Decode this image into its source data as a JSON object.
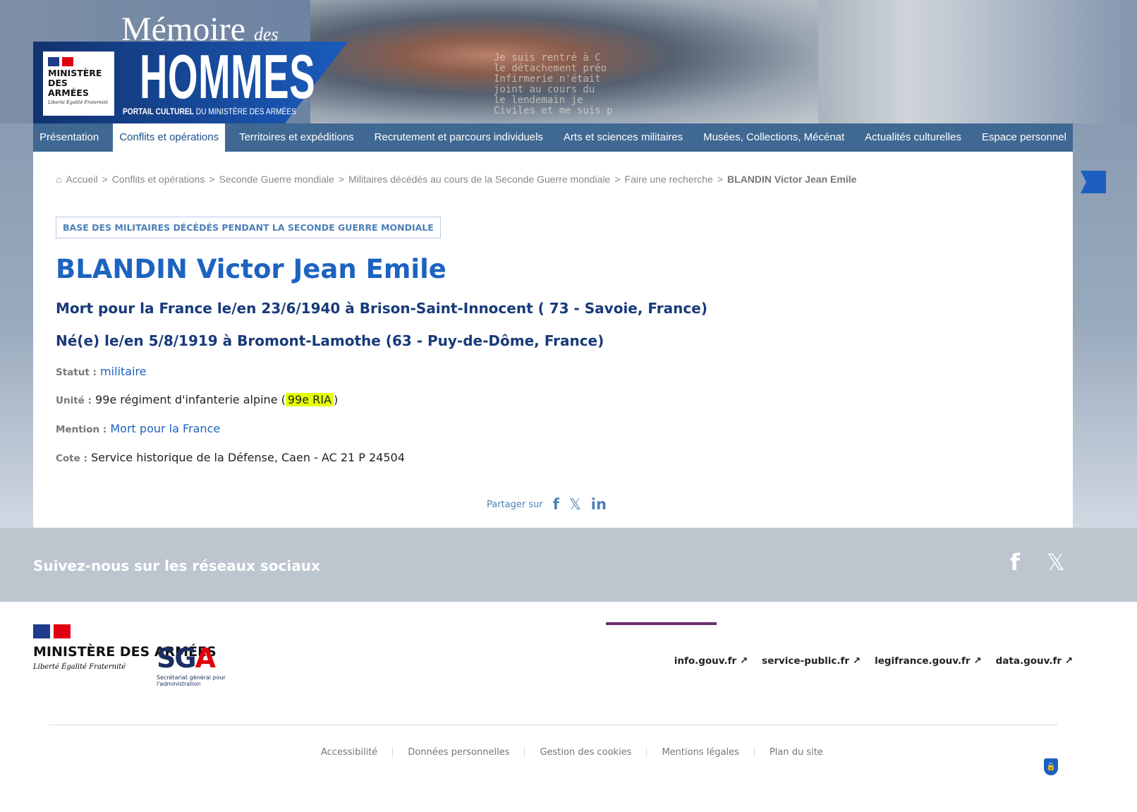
{
  "header": {
    "title_1": "Mémoire",
    "title_2": "des",
    "title_3": "HOMMES",
    "subtitle_bold": "PORTAIL CULTUREL",
    "subtitle": " DU MINISTÈRE DES ARMÉES",
    "ministry": "MINISTÈRE DES ARMÉES",
    "motto": "Liberté Égalité Fraternité",
    "quote": "Je suis rentré à C\nle détachement préo\nInfirmerie n'était \njoint au cours du \nle lendemain je \nCiviles et me suis p"
  },
  "nav": [
    "Présentation",
    "Conflits et opérations",
    "Territoires et expéditions",
    "Recrutement et parcours individuels",
    "Arts et sciences militaires",
    "Musées, Collections, Mécénat",
    "Actualités culturelles",
    "Espace personnel"
  ],
  "breadcrumb": [
    "Accueil",
    "Conflits et opérations",
    "Seconde Guerre mondiale",
    "Militaires décédés au cours de la Seconde Guerre mondiale",
    "Faire une recherche",
    "BLANDIN Victor Jean Emile"
  ],
  "record": {
    "badge": "BASE DES MILITAIRES DÉCÉDÉS PENDANT LA SECONDE GUERRE MONDIALE",
    "name": "BLANDIN Victor Jean Emile",
    "death": "Mort pour la France le/en 23/6/1940 à Brison-Saint-Innocent ( 73 - Savoie, France)",
    "birth": "Né(e) le/en 5/8/1919 à Bromont-Lamothe (63 - Puy-de-Dôme, France)",
    "statut_label": "Statut :",
    "statut": "militaire",
    "unite_label": "Unité :",
    "unite": "99e régiment d'infanterie alpine (",
    "unite_abbr": "99e RIA",
    "unite_end": ")",
    "mention_label": "Mention :",
    "mention": "Mort pour la France",
    "cote_label": "Cote :",
    "cote": "Service historique de la Défense, Caen - AC 21 P 24504"
  },
  "share": {
    "label": "Partager sur",
    "fb": "f",
    "x": "𝕏",
    "in": "in"
  },
  "social": {
    "title": "Suivez-nous sur les réseaux sociaux",
    "fb": "f",
    "x": "𝕏"
  },
  "footer": {
    "ministry": "MINISTÈRE DES ARMÉES",
    "motto": "Liberté Égalité Fraternité",
    "sga": "SG",
    "sga_a": "A",
    "sga_sub": "Secrétariat général pour l'administration",
    "links": [
      "info.gouv.fr ↗",
      "service-public.fr ↗",
      "legifrance.gouv.fr ↗",
      "data.gouv.fr ↗"
    ],
    "bottom": [
      "Accessibilité",
      "Données personnelles",
      "Gestion des cookies",
      "Mentions légales",
      "Plan du site"
    ]
  }
}
